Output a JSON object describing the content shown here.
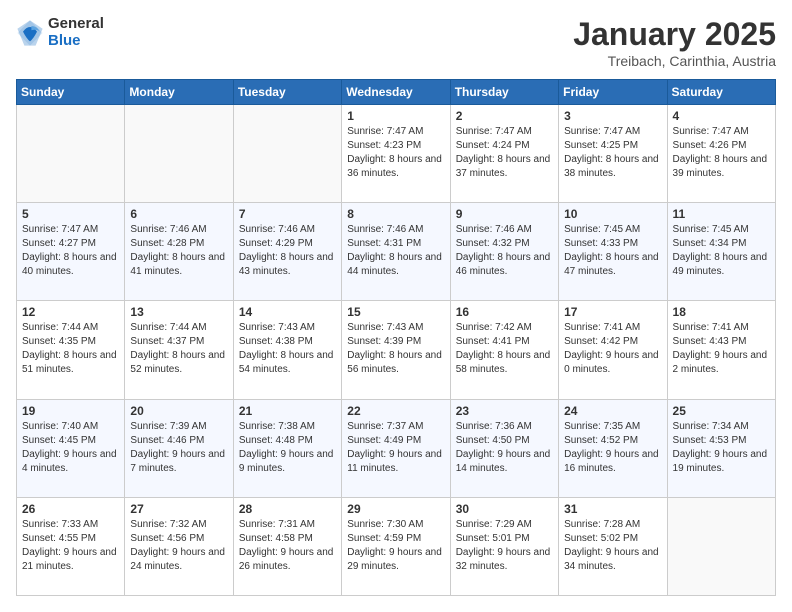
{
  "header": {
    "logo_general": "General",
    "logo_blue": "Blue",
    "month_title": "January 2025",
    "subtitle": "Treibach, Carinthia, Austria"
  },
  "days_of_week": [
    "Sunday",
    "Monday",
    "Tuesday",
    "Wednesday",
    "Thursday",
    "Friday",
    "Saturday"
  ],
  "weeks": [
    [
      {
        "day": "",
        "info": ""
      },
      {
        "day": "",
        "info": ""
      },
      {
        "day": "",
        "info": ""
      },
      {
        "day": "1",
        "info": "Sunrise: 7:47 AM\nSunset: 4:23 PM\nDaylight: 8 hours and 36 minutes."
      },
      {
        "day": "2",
        "info": "Sunrise: 7:47 AM\nSunset: 4:24 PM\nDaylight: 8 hours and 37 minutes."
      },
      {
        "day": "3",
        "info": "Sunrise: 7:47 AM\nSunset: 4:25 PM\nDaylight: 8 hours and 38 minutes."
      },
      {
        "day": "4",
        "info": "Sunrise: 7:47 AM\nSunset: 4:26 PM\nDaylight: 8 hours and 39 minutes."
      }
    ],
    [
      {
        "day": "5",
        "info": "Sunrise: 7:47 AM\nSunset: 4:27 PM\nDaylight: 8 hours and 40 minutes."
      },
      {
        "day": "6",
        "info": "Sunrise: 7:46 AM\nSunset: 4:28 PM\nDaylight: 8 hours and 41 minutes."
      },
      {
        "day": "7",
        "info": "Sunrise: 7:46 AM\nSunset: 4:29 PM\nDaylight: 8 hours and 43 minutes."
      },
      {
        "day": "8",
        "info": "Sunrise: 7:46 AM\nSunset: 4:31 PM\nDaylight: 8 hours and 44 minutes."
      },
      {
        "day": "9",
        "info": "Sunrise: 7:46 AM\nSunset: 4:32 PM\nDaylight: 8 hours and 46 minutes."
      },
      {
        "day": "10",
        "info": "Sunrise: 7:45 AM\nSunset: 4:33 PM\nDaylight: 8 hours and 47 minutes."
      },
      {
        "day": "11",
        "info": "Sunrise: 7:45 AM\nSunset: 4:34 PM\nDaylight: 8 hours and 49 minutes."
      }
    ],
    [
      {
        "day": "12",
        "info": "Sunrise: 7:44 AM\nSunset: 4:35 PM\nDaylight: 8 hours and 51 minutes."
      },
      {
        "day": "13",
        "info": "Sunrise: 7:44 AM\nSunset: 4:37 PM\nDaylight: 8 hours and 52 minutes."
      },
      {
        "day": "14",
        "info": "Sunrise: 7:43 AM\nSunset: 4:38 PM\nDaylight: 8 hours and 54 minutes."
      },
      {
        "day": "15",
        "info": "Sunrise: 7:43 AM\nSunset: 4:39 PM\nDaylight: 8 hours and 56 minutes."
      },
      {
        "day": "16",
        "info": "Sunrise: 7:42 AM\nSunset: 4:41 PM\nDaylight: 8 hours and 58 minutes."
      },
      {
        "day": "17",
        "info": "Sunrise: 7:41 AM\nSunset: 4:42 PM\nDaylight: 9 hours and 0 minutes."
      },
      {
        "day": "18",
        "info": "Sunrise: 7:41 AM\nSunset: 4:43 PM\nDaylight: 9 hours and 2 minutes."
      }
    ],
    [
      {
        "day": "19",
        "info": "Sunrise: 7:40 AM\nSunset: 4:45 PM\nDaylight: 9 hours and 4 minutes."
      },
      {
        "day": "20",
        "info": "Sunrise: 7:39 AM\nSunset: 4:46 PM\nDaylight: 9 hours and 7 minutes."
      },
      {
        "day": "21",
        "info": "Sunrise: 7:38 AM\nSunset: 4:48 PM\nDaylight: 9 hours and 9 minutes."
      },
      {
        "day": "22",
        "info": "Sunrise: 7:37 AM\nSunset: 4:49 PM\nDaylight: 9 hours and 11 minutes."
      },
      {
        "day": "23",
        "info": "Sunrise: 7:36 AM\nSunset: 4:50 PM\nDaylight: 9 hours and 14 minutes."
      },
      {
        "day": "24",
        "info": "Sunrise: 7:35 AM\nSunset: 4:52 PM\nDaylight: 9 hours and 16 minutes."
      },
      {
        "day": "25",
        "info": "Sunrise: 7:34 AM\nSunset: 4:53 PM\nDaylight: 9 hours and 19 minutes."
      }
    ],
    [
      {
        "day": "26",
        "info": "Sunrise: 7:33 AM\nSunset: 4:55 PM\nDaylight: 9 hours and 21 minutes."
      },
      {
        "day": "27",
        "info": "Sunrise: 7:32 AM\nSunset: 4:56 PM\nDaylight: 9 hours and 24 minutes."
      },
      {
        "day": "28",
        "info": "Sunrise: 7:31 AM\nSunset: 4:58 PM\nDaylight: 9 hours and 26 minutes."
      },
      {
        "day": "29",
        "info": "Sunrise: 7:30 AM\nSunset: 4:59 PM\nDaylight: 9 hours and 29 minutes."
      },
      {
        "day": "30",
        "info": "Sunrise: 7:29 AM\nSunset: 5:01 PM\nDaylight: 9 hours and 32 minutes."
      },
      {
        "day": "31",
        "info": "Sunrise: 7:28 AM\nSunset: 5:02 PM\nDaylight: 9 hours and 34 minutes."
      },
      {
        "day": "",
        "info": ""
      }
    ]
  ]
}
